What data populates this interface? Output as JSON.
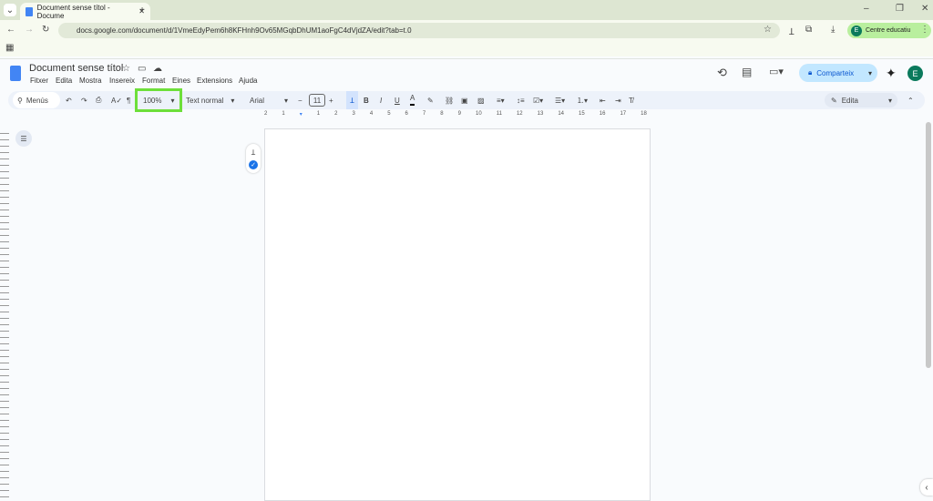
{
  "browser": {
    "tab_title": "Document sense títol - Docume",
    "url": "docs.google.com/document/d/1VmeEdyPem6h8KFHnh9Ov65MGqbDhUM1aoFgC4dVjdZA/edit?tab=t.0",
    "profile_initial": "E",
    "profile_label": "Centre educatiu"
  },
  "doc": {
    "title": "Document sense títol",
    "menus": [
      "Fitxer",
      "Edita",
      "Mostra",
      "Insereix",
      "Format",
      "Eines",
      "Extensions",
      "Ajuda"
    ],
    "share_label": "Comparteix",
    "avatar": "E"
  },
  "toolbar": {
    "search": "Menús",
    "zoom": "100%",
    "style": "Text normal",
    "font": "Arial",
    "font_size": "11",
    "mode": "Edita"
  },
  "ruler": [
    "2",
    "1",
    "1",
    "2",
    "3",
    "4",
    "5",
    "6",
    "7",
    "8",
    "9",
    "10",
    "11",
    "12",
    "13",
    "14",
    "15",
    "16",
    "17",
    "18"
  ],
  "colors": {
    "highlight": "#6ddf3a",
    "accent": "#c2e7ff"
  }
}
